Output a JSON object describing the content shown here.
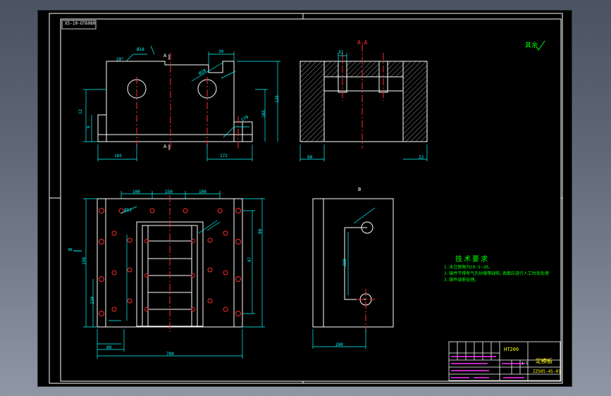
{
  "drawing": {
    "header_box_text": "X5-10-GT6080",
    "roughness_note": "其余",
    "section_label": "A-A",
    "view_b_label": "B",
    "cut_a_top": "A",
    "cut_a_bottom": "A",
    "side_b_label": "B"
  },
  "dimensions": {
    "top_view": [
      "20°",
      "Ø18",
      "30",
      "165",
      "Ø28",
      "172",
      "9",
      "12",
      "165",
      "125",
      "170",
      "225",
      "20"
    ],
    "section_view": [
      "32",
      "90",
      "90",
      "28",
      "35",
      "100",
      "22"
    ],
    "plan_view": [
      "100",
      "150",
      "100",
      "Ø13",
      "150",
      "220",
      "97",
      "90",
      "70",
      "168",
      "700",
      "80",
      "100",
      "60"
    ],
    "b_view": [
      "200",
      "280"
    ]
  },
  "tech_requirements": {
    "title": "技术要求",
    "items": [
      "1.未注倒角为C0.5~1R。",
      "2.铸件不得有气孔砂眼等缺陷,表面应进行人工时效处理",
      "3.铸件调质处理。"
    ]
  },
  "title_block": {
    "material": "HT200",
    "part_name": "定模板",
    "drawing_no": "ZZS05-45-01",
    "scale": "1:1"
  },
  "colors": {
    "line": "#ffffff",
    "dimension": "#00ffff",
    "center": "#ff2a2a",
    "annotation": "#00ff00",
    "title_text": "#ffff00",
    "magenta": "#ff33ff"
  }
}
